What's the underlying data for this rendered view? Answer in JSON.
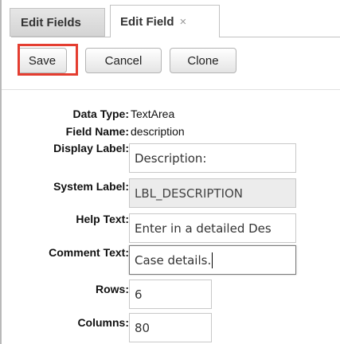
{
  "tabs": [
    {
      "label": "Edit Fields"
    },
    {
      "label": "Edit Field",
      "close": "×"
    }
  ],
  "toolbar": {
    "save_label": "Save",
    "cancel_label": "Cancel",
    "clone_label": "Clone",
    "highlight_color": "#e43d30"
  },
  "form": {
    "data_type": {
      "label": "Data Type:",
      "value": "TextArea"
    },
    "field_name": {
      "label": "Field Name:",
      "value": "description"
    },
    "display_label": {
      "label": "Display Label:",
      "value": "Description:"
    },
    "system_label": {
      "label": "System Label:",
      "value": "LBL_DESCRIPTION"
    },
    "help_text": {
      "label": "Help Text:",
      "value": "Enter in a detailed Des"
    },
    "comment_text": {
      "label": "Comment Text:",
      "value": "Case details."
    },
    "rows": {
      "label": "Rows:",
      "value": "6"
    },
    "columns": {
      "label": "Columns:",
      "value": "80"
    }
  }
}
